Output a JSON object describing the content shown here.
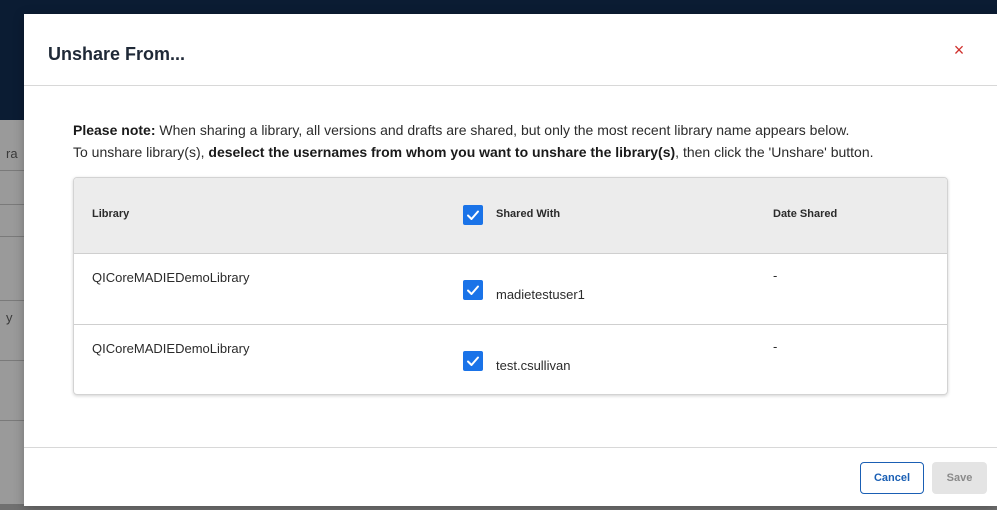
{
  "background": {
    "sidebar_text": "ra",
    "sidebar_text2": "y"
  },
  "modal": {
    "title": "Unshare From...",
    "close_glyph": "×",
    "note": {
      "line1_bold": "Please note:",
      "line1_text": " When sharing a library, all versions and drafts are shared, but only the most recent library name appears below.",
      "line2_pre": "To unshare library(s), ",
      "line2_bold": "deselect the usernames from whom you want to unshare the library(s)",
      "line2_post": ", then click the 'Unshare' button."
    },
    "table": {
      "headers": {
        "library": "Library",
        "shared_with": "Shared With",
        "date_shared": "Date Shared"
      },
      "select_all_checked": true,
      "rows": [
        {
          "library": "QICoreMADIEDemoLibrary",
          "user": "madietestuser1",
          "date": "-",
          "checked": true
        },
        {
          "library": "QICoreMADIEDemoLibrary",
          "user": "test.csullivan",
          "date": "-",
          "checked": true
        }
      ]
    },
    "footer": {
      "cancel_label": "Cancel",
      "save_label": "Save"
    }
  },
  "colors": {
    "checkbox": "#1a73e8",
    "cancel": "#1a5fb4",
    "close": "#d0312d"
  }
}
